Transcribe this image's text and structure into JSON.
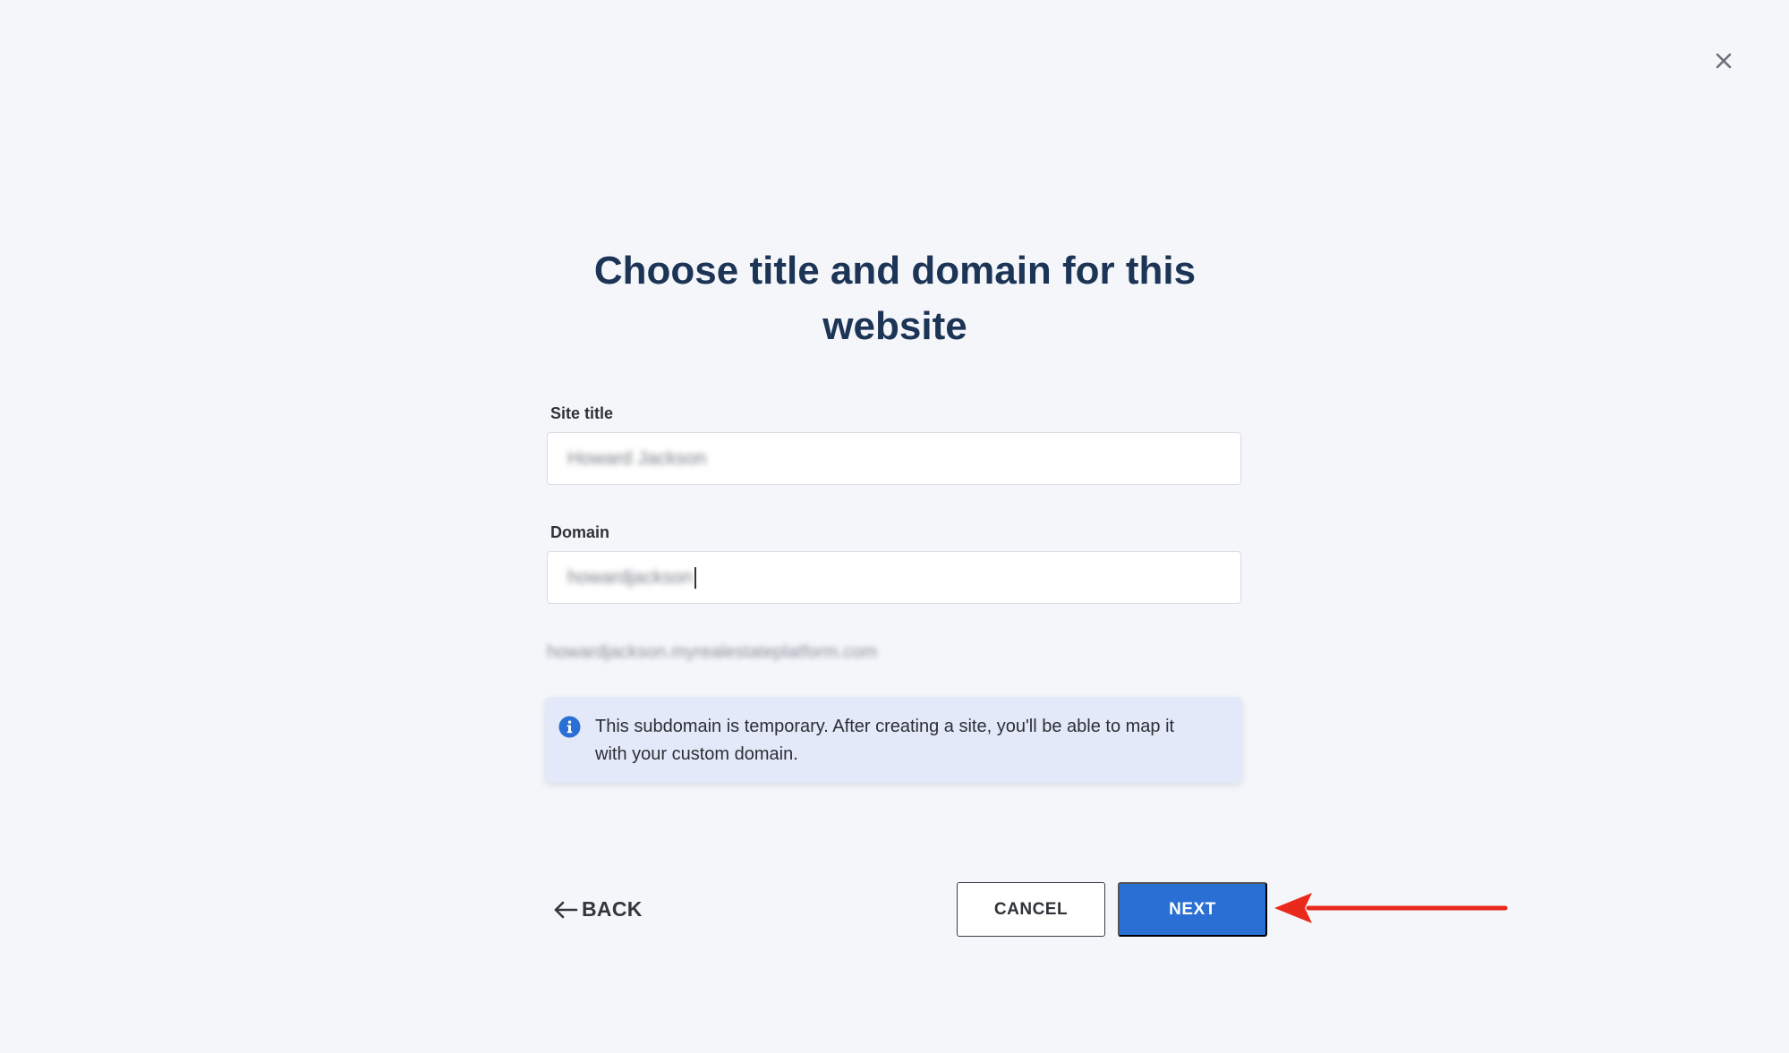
{
  "dialog": {
    "title": "Choose title and domain for this website",
    "close_icon": "close-icon"
  },
  "form": {
    "site_title": {
      "label": "Site title",
      "value": "Howard Jackson"
    },
    "domain": {
      "label": "Domain",
      "value": "howardjackson"
    },
    "url_preview": "howardjackson.myrealestateplatform.com"
  },
  "info": {
    "icon": "info-icon",
    "text_line1": "This subdomain is temporary. After creating a site, you'll be able to map it",
    "text_line2": "with your custom domain.",
    "color": "#2a6fd4"
  },
  "actions": {
    "back_label": "BACK",
    "back_icon": "arrow-left-icon",
    "cancel_label": "CANCEL",
    "next_label": "NEXT",
    "next_color": "#2a6fd4"
  },
  "annotation": {
    "icon": "red-arrow-icon",
    "color": "#e8291c"
  }
}
